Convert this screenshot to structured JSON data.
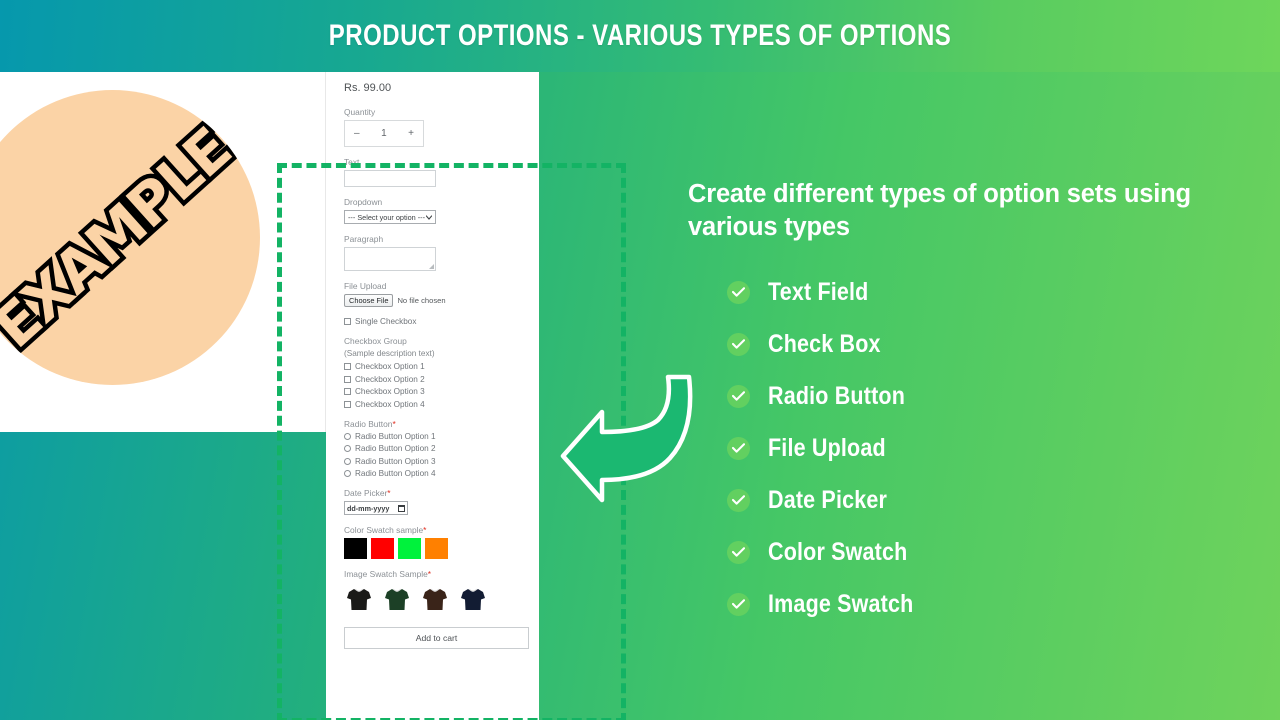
{
  "banner": {
    "title": "PRODUCT OPTIONS - VARIOUS TYPES OF OPTIONS"
  },
  "product_panel": {
    "badge_text": "EXAMPLE",
    "badge_color": "#fbd3a6"
  },
  "form": {
    "price": "Rs. 99.00",
    "quantity": {
      "label": "Quantity",
      "minus": "–",
      "value": "1",
      "plus": "+"
    },
    "text_field": {
      "label": "Text",
      "value": ""
    },
    "dropdown": {
      "label": "Dropdown",
      "selected": "--- Select your option ---",
      "caret": "⌄"
    },
    "paragraph": {
      "label": "Paragraph",
      "value": ""
    },
    "file_upload": {
      "label": "File Upload",
      "button": "Choose File",
      "status": "No file chosen"
    },
    "single_checkbox": {
      "label": "Single Checkbox"
    },
    "checkbox_group": {
      "label": "Checkbox Group",
      "description": "(Sample description text)",
      "options": [
        "Checkbox Option 1",
        "Checkbox Option 2",
        "Checkbox Option 3",
        "Checkbox Option 4"
      ]
    },
    "radio_group": {
      "label": "Radio Button",
      "required": "*",
      "options": [
        "Radio Button Option 1",
        "Radio Button Option 2",
        "Radio Button Option 3",
        "Radio Button Option 4"
      ]
    },
    "date_picker": {
      "label": "Date Picker",
      "required": "*",
      "value": "dd-mm-yyyy"
    },
    "color_swatch": {
      "label": "Color Swatch sample",
      "required": "*",
      "colors": [
        "#000000",
        "#ff0000",
        "#00f23c",
        "#ff8000"
      ]
    },
    "image_swatch": {
      "label": "Image Swatch Sample",
      "required": "*",
      "shirts": [
        "#1a1a18",
        "#1c4026",
        "#3a2419",
        "#121c33"
      ]
    },
    "add_to_cart": "Add to cart"
  },
  "highlight": {
    "border_color": "#13b364"
  },
  "arrow": {
    "fill": "#1bb871",
    "stroke": "#ffffff"
  },
  "right": {
    "headline": "Create different types of option sets using various types",
    "check_color": "#62d060",
    "features": [
      "Text Field",
      "Check Box",
      "Radio Button",
      "File Upload",
      "Date Picker",
      "Color Swatch",
      "Image Swatch"
    ]
  }
}
